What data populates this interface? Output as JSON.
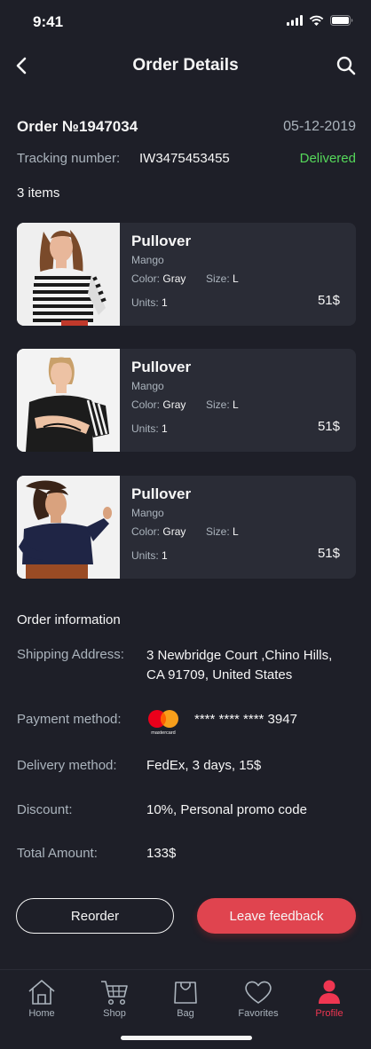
{
  "status_bar": {
    "time": "9:41"
  },
  "header": {
    "title": "Order Details"
  },
  "order": {
    "number": "Order №1947034",
    "date": "05-12-2019",
    "tracking_label": "Tracking number:",
    "tracking_number": "IW3475453455",
    "status": "Delivered",
    "items_count": "3 items"
  },
  "items": [
    {
      "name": "Pullover",
      "brand": "Mango",
      "color_label": "Color:",
      "color": "Gray",
      "size_label": "Size:",
      "size": "L",
      "units_label": "Units:",
      "units": "1",
      "price": "51$"
    },
    {
      "name": "Pullover",
      "brand": "Mango",
      "color_label": "Color:",
      "color": "Gray",
      "size_label": "Size:",
      "size": "L",
      "units_label": "Units:",
      "units": "1",
      "price": "51$"
    },
    {
      "name": "Pullover",
      "brand": "Mango",
      "color_label": "Color:",
      "color": "Gray",
      "size_label": "Size:",
      "size": "L",
      "units_label": "Units:",
      "units": "1",
      "price": "51$"
    }
  ],
  "order_info": {
    "title": "Order information",
    "shipping_label": "Shipping Address:",
    "shipping_line1": "3 Newbridge Court ,Chino Hills,",
    "shipping_line2": "CA 91709, United States",
    "payment_label": "Payment method:",
    "card_brand_text": "mastercard",
    "card_number": "**** **** **** 3947",
    "delivery_label": "Delivery method:",
    "delivery_value": "FedEx, 3 days, 15$",
    "discount_label": "Discount:",
    "discount_value": "10%, Personal promo code",
    "total_label": "Total Amount:",
    "total_value": "133$"
  },
  "actions": {
    "reorder": "Reorder",
    "feedback": "Leave feedback"
  },
  "tabs": [
    {
      "label": "Home",
      "icon": "home-icon"
    },
    {
      "label": "Shop",
      "icon": "cart-icon"
    },
    {
      "label": "Bag",
      "icon": "bag-icon"
    },
    {
      "label": "Favorites",
      "icon": "heart-icon"
    },
    {
      "label": "Profile",
      "icon": "profile-icon",
      "active": true
    }
  ],
  "colors": {
    "background": "#1E1F28",
    "card": "#2A2C36",
    "accent": "#EF3651",
    "button": "#E0444F",
    "success": "#55D85A",
    "muted": "#ABB4BD",
    "text": "#F6F6F6"
  }
}
